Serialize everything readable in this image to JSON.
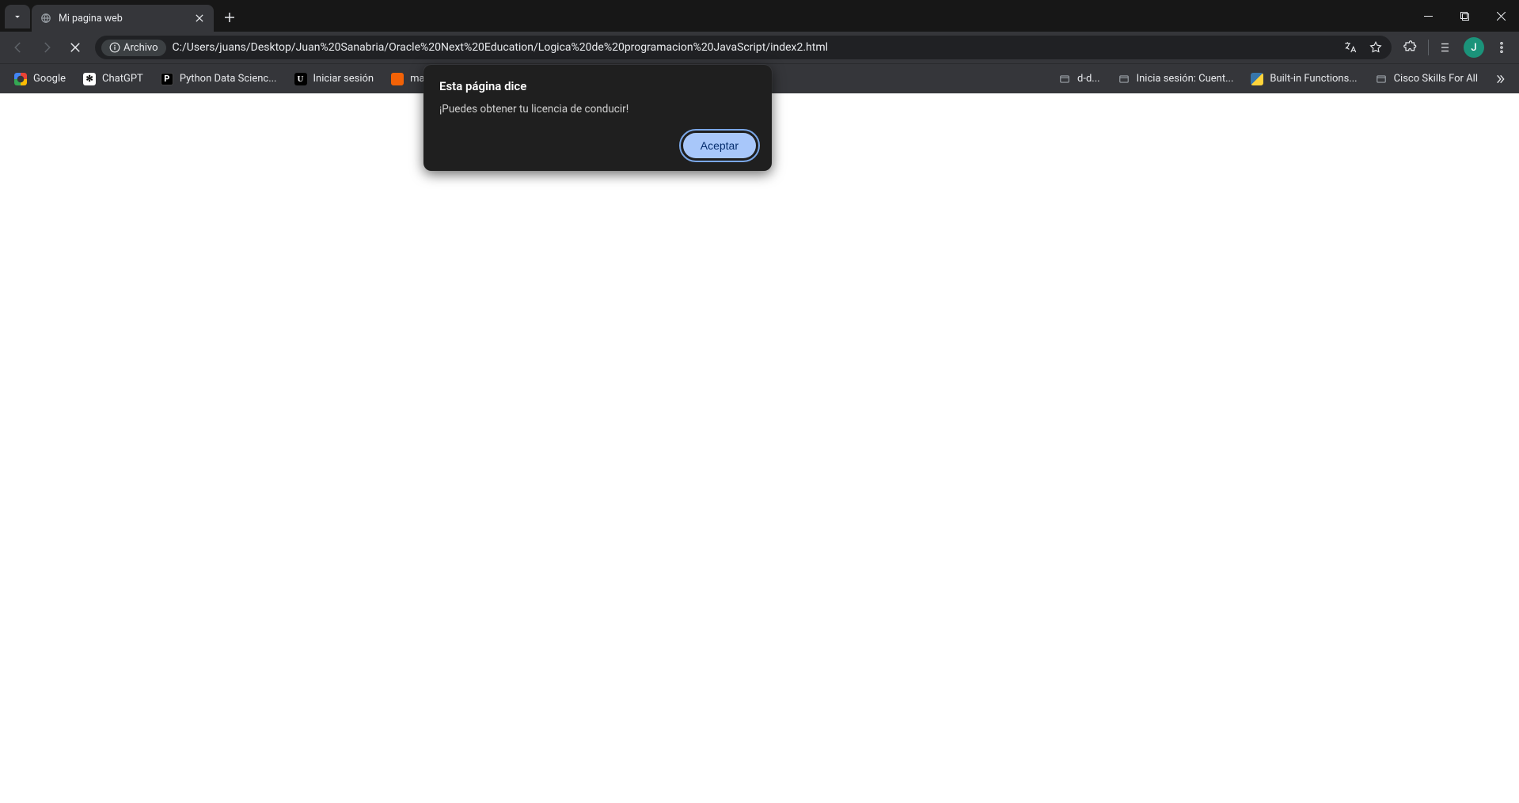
{
  "tab": {
    "title": "Mi pagina web"
  },
  "omnibox": {
    "security_label": "Archivo",
    "url": "C:/Users/juans/Desktop/Juan%20Sanabria/Oracle%20Next%20Education/Logica%20de%20programacion%20JavaScript/index2.html"
  },
  "avatar_initial": "J",
  "bookmarks": [
    {
      "label": "Google",
      "icon": "google"
    },
    {
      "label": "ChatGPT",
      "icon": "chatgpt"
    },
    {
      "label": "Python Data Scienc...",
      "icon": "p"
    },
    {
      "label": "Iniciar sesión",
      "icon": "u"
    },
    {
      "label": "main.py - Unlawfu...",
      "icon": "replit"
    },
    {
      "label": "d-d...",
      "icon": "placeholder"
    },
    {
      "label": "Inicia sesión: Cuent...",
      "icon": "placeholder"
    },
    {
      "label": "Built-in Functions...",
      "icon": "python"
    },
    {
      "label": "Cisco Skills For All",
      "icon": "cisco"
    }
  ],
  "dialog": {
    "title": "Esta página dice",
    "message": "¡Puedes obtener tu licencia de conducir!",
    "accept": "Aceptar"
  }
}
